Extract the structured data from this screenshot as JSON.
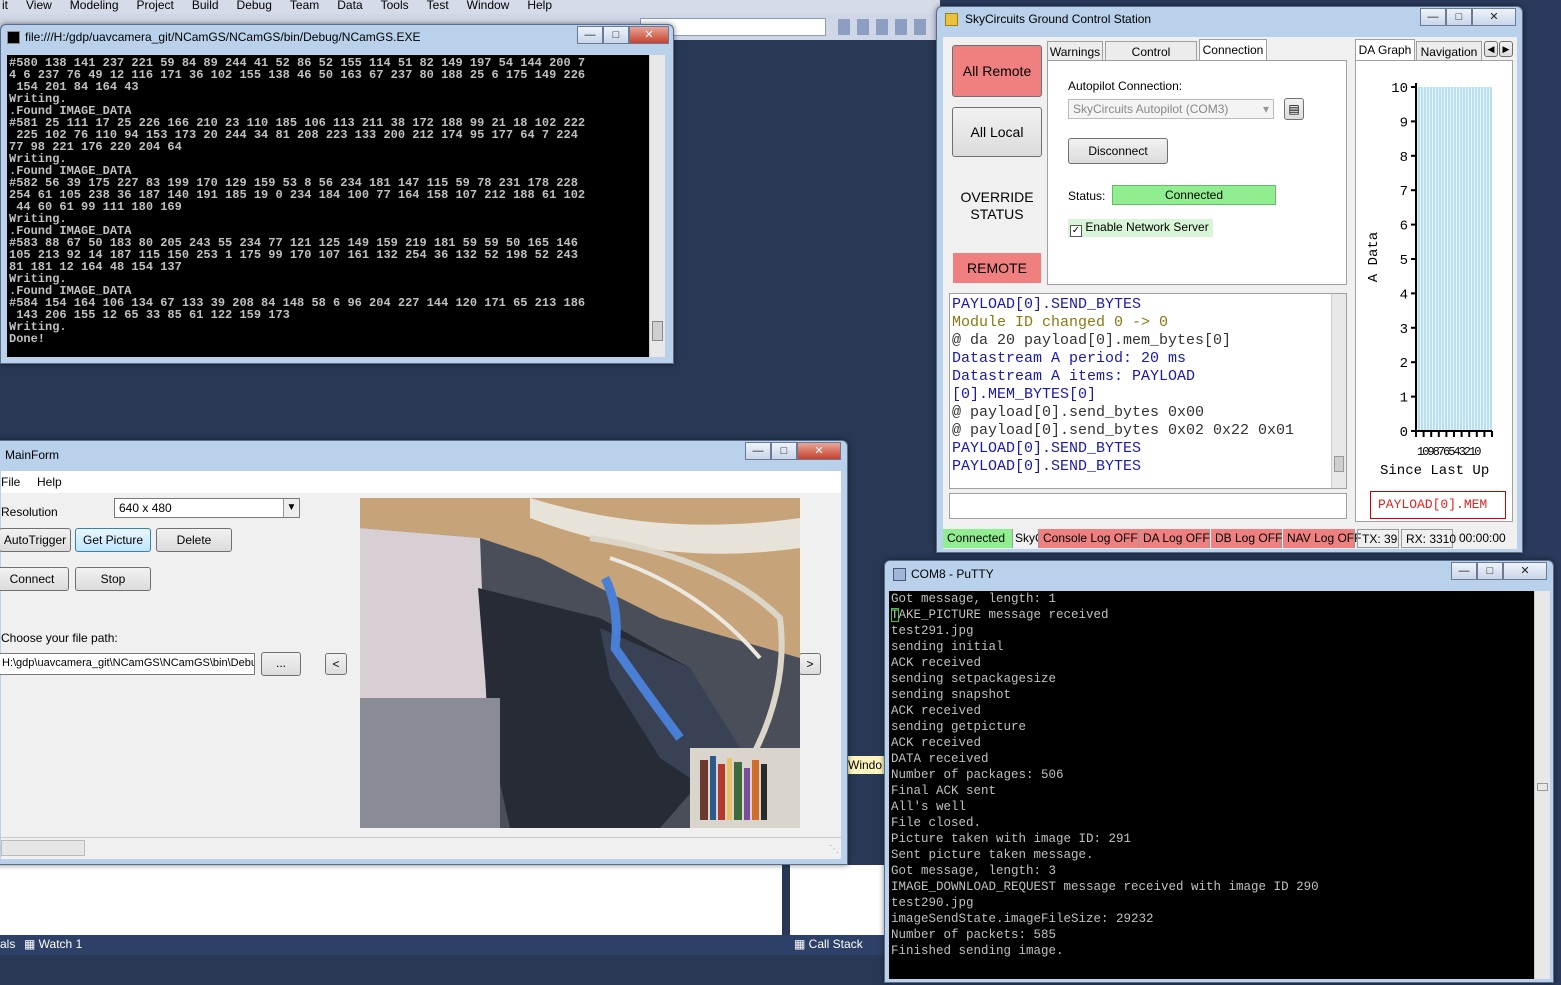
{
  "vs": {
    "menu": [
      "it",
      "View",
      "Modeling",
      "Project",
      "Build",
      "Debug",
      "Team",
      "Data",
      "Tools",
      "Test",
      "Window",
      "Help"
    ],
    "bottom_tabs": {
      "locals": "als",
      "watch": "Watch 1",
      "callstack": "Call Stack"
    },
    "window_text": "Windo"
  },
  "console": {
    "title": "file:///H:/gdp/uavcamera_git/NCamGS/NCamGS/bin/Debug/NCamGS.EXE",
    "lines": [
      "#580 138 141 237 221 59 84 89 244 41 52 86 52 155 114 51 82 149 197 54 144 200 7",
      "4 6 237 76 49 12 116 171 36 102 155 138 46 50 163 67 237 80 188 25 6 175 149 226",
      " 154 201 84 164 43",
      "Writing.",
      ".Found IMAGE_DATA",
      "#581 25 111 17 25 226 166 210 23 110 185 106 113 211 38 172 188 99 21 18 102 222",
      " 225 102 76 110 94 153 173 20 244 34 81 208 223 133 200 212 174 95 177 64 7 224",
      "77 98 221 176 220 204 64",
      "Writing.",
      ".Found IMAGE_DATA",
      "#582 56 39 175 227 83 199 170 129 159 53 8 56 234 181 147 115 59 78 231 178 228",
      "254 61 105 238 36 187 140 191 185 19 0 234 184 100 77 164 158 107 212 188 61 102",
      " 44 60 61 99 111 180 169",
      "Writing.",
      ".Found IMAGE_DATA",
      "#583 88 67 50 183 80 205 243 55 234 77 121 125 149 159 219 181 59 59 50 165 146",
      "105 213 92 14 187 115 150 253 1 175 99 170 107 161 132 254 36 132 52 198 52 243",
      "81 181 12 164 48 154 137",
      "Writing.",
      ".Found IMAGE_DATA",
      "#584 154 164 106 134 67 133 39 208 84 148 58 6 96 204 227 144 120 171 65 213 186",
      " 143 206 155 12 65 33 85 61 122 159 173",
      "Writing.",
      "Done!"
    ]
  },
  "gcs": {
    "title": "SkyCircuits Ground Control Station",
    "all_remote": "All Remote",
    "all_local": "All Local",
    "override_status": "OVERRIDE STATUS",
    "override_value": "REMOTE",
    "tabs": [
      "Warnings",
      "Control Switching",
      "Connection"
    ],
    "autopilot_label": "Autopilot Connection:",
    "autopilot_value": "SkyCircuits Autopilot (COM3)",
    "disconnect": "Disconnect",
    "status_label": "Status:",
    "status_value": "Connected",
    "network_server": "Enable Network Server",
    "log": [
      {
        "t": "PAYLOAD[0].SEND_BYTES",
        "c": "#1a1aa8"
      },
      {
        "t": "Module ID changed 0 -> 0",
        "c": "#8a7a10"
      },
      {
        "t": "@ da 20 payload[0].mem_bytes[0]",
        "c": "#333333"
      },
      {
        "t": "Datastream A period: 20 ms",
        "c": "#1a1aa8"
      },
      {
        "t": "Datastream A items: PAYLOAD",
        "c": "#1a1aa8"
      },
      {
        "t": "[0].MEM_BYTES[0]",
        "c": "#1a1aa8"
      },
      {
        "t": "@ payload[0].send_bytes 0x00",
        "c": "#333333"
      },
      {
        "t": "@ payload[0].send_bytes 0x02 0x22 0x01",
        "c": "#333333"
      },
      {
        "t": "PAYLOAD[0].SEND_BYTES",
        "c": "#1a1aa8"
      },
      {
        "t": "PAYLOAD[0].SEND_BYTES",
        "c": "#1a1aa8"
      }
    ],
    "graph_tabs": [
      "DA Graph",
      "Navigation"
    ],
    "graph_ylabel": "A Data",
    "graph_xlabel": "Since Last Up",
    "graph_xticks": "109876543210",
    "graph_yticks": [
      "10",
      "9",
      "8",
      "7",
      "6",
      "5",
      "4",
      "3",
      "2",
      "1",
      "0"
    ],
    "graph_item": "PAYLOAD[0].MEM",
    "statusbar": [
      "Connected",
      "SkyC",
      "Console Log OFF",
      "DA Log OFF",
      "DB Log OFF",
      "NAV Log OFF",
      "TX: 39",
      "RX: 3310",
      "00:00:00"
    ]
  },
  "mainform": {
    "title": "MainForm",
    "menu": [
      "File",
      "Help"
    ],
    "resolution_label": "Resolution",
    "resolution_value": "640 x 480",
    "autotrigger": "AutoTrigger",
    "get_picture": "Get Picture",
    "delete": "Delete",
    "connect": "Connect",
    "stop": "Stop",
    "path_label": "Choose your file path:",
    "path_value": "H:\\gdp\\uavcamera_git\\NCamGS\\NCamGS\\bin\\Debug",
    "browse": "...",
    "prev": "<",
    "next": ">"
  },
  "putty": {
    "title": "COM8 - PuTTY",
    "lines": [
      "Got message, length: 1",
      "TAKE_PICTURE message received",
      "test291.jpg",
      "sending initial",
      "ACK received",
      "sending setpackagesize",
      "sending snapshot",
      "ACK received",
      "sending getpicture",
      "ACK received",
      "DATA received",
      "Number of packages: 506",
      "Final ACK sent",
      "All's well",
      "File closed.",
      "Picture taken with image ID: 291",
      "Sent picture taken message.",
      "Got message, length: 3",
      "IMAGE_DOWNLOAD_REQUEST message received with image ID 290",
      "test290.jpg",
      "imageSendState.imageFileSize: 29232",
      "Number of packets: 585",
      "Finished sending image."
    ]
  }
}
